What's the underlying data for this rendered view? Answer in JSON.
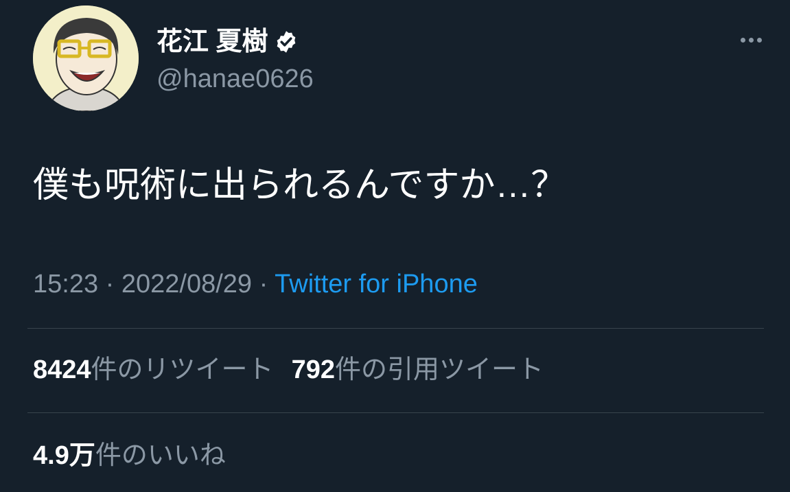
{
  "user": {
    "display_name": "花江 夏樹",
    "handle": "@hanae0626",
    "verified": true
  },
  "tweet": {
    "text": "僕も呪術に出られるんですか…？",
    "time": "15:23",
    "separator": "·",
    "date": "2022/08/29",
    "source": "Twitter for iPhone"
  },
  "stats": {
    "retweets_count": "8424",
    "retweets_label": "件のリツイート",
    "quotes_count": "792",
    "quotes_label": "件の引用ツイート",
    "likes_count": "4.9万",
    "likes_label": "件のいいね"
  },
  "icons": {
    "verified": "verified-badge-icon",
    "more": "more-horizontal-icon"
  },
  "colors": {
    "background": "#15202b",
    "text_primary": "#ffffff",
    "text_secondary": "#8b98a5",
    "link": "#1d9bf0",
    "divider": "#38444d"
  }
}
